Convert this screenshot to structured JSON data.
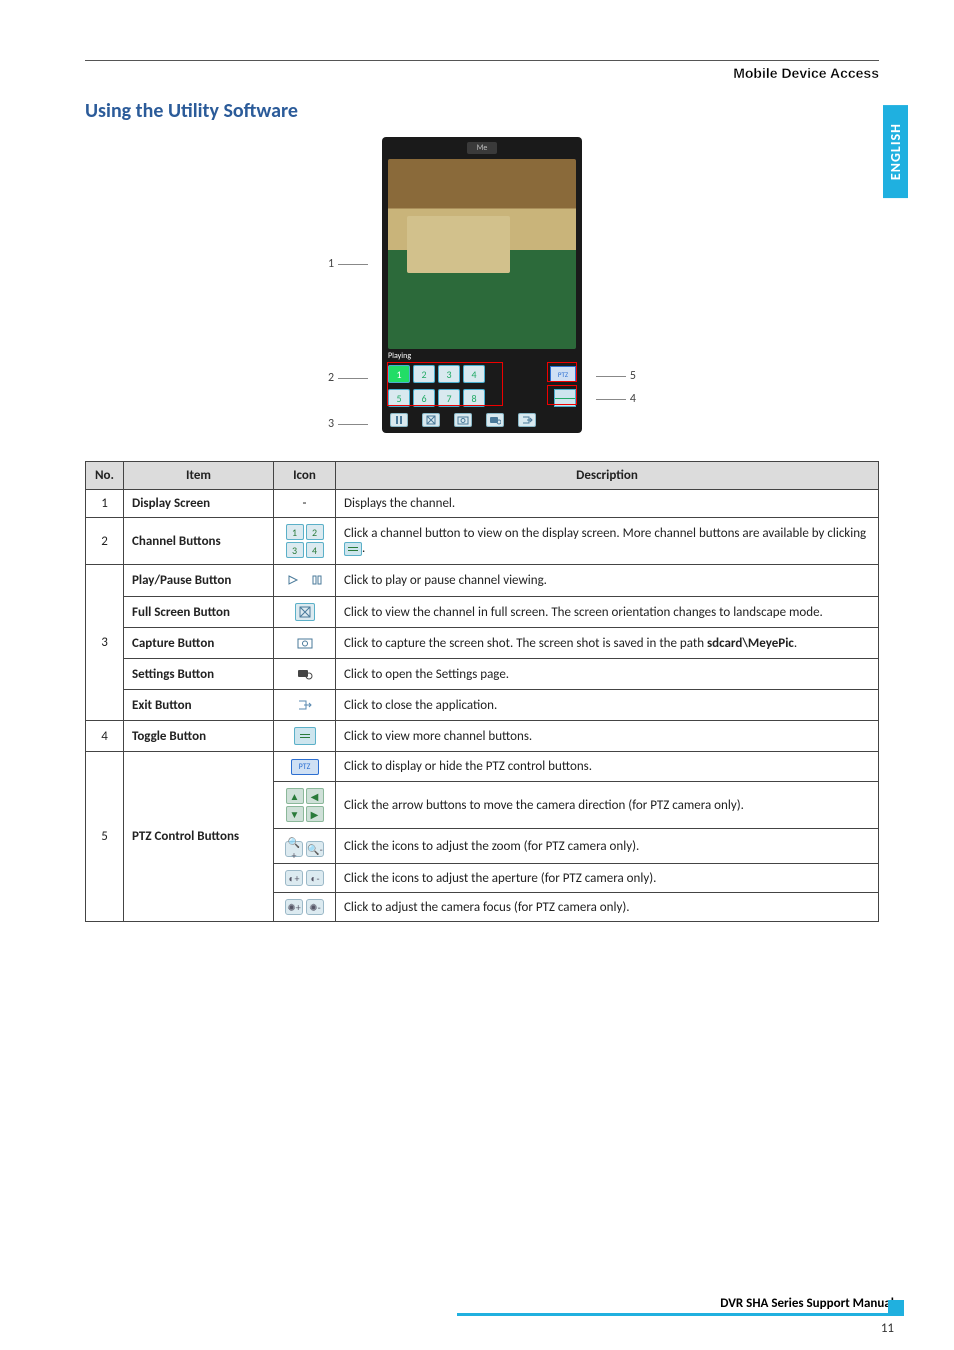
{
  "header": {
    "section": "Mobile Device Access"
  },
  "language_tab": "ENGLISH",
  "section_title": "Using the Utility Software",
  "figure": {
    "title_bar": "Me",
    "status_text": "Playing",
    "callouts": {
      "c1": "1",
      "c2": "2",
      "c3": "3",
      "c4": "4",
      "c5": "5"
    },
    "channel_labels": [
      "1",
      "2",
      "3",
      "4",
      "5",
      "6",
      "7",
      "8"
    ],
    "ptz_label": "PTZ"
  },
  "table": {
    "headers": {
      "no": "No.",
      "item": "Item",
      "icon": "Icon",
      "desc": "Description"
    },
    "rows": {
      "r1": {
        "no": "1",
        "item": "Display Screen",
        "icon_text": "-",
        "desc": "Displays the channel."
      },
      "r2": {
        "no": "2",
        "item": "Channel Buttons",
        "desc_a": "Click a channel button to view on the display screen. More channel buttons are available by clicking ",
        "desc_b": "."
      },
      "r3no": "3",
      "r3a": {
        "item": "Play/Pause Button",
        "desc": "Click to play or pause channel viewing."
      },
      "r3b": {
        "item": "Full Screen Button",
        "desc": "Click to view the channel in full screen. The screen orientation changes to landscape mode."
      },
      "r3c": {
        "item": "Capture Button",
        "desc_a": "Click to capture the screen shot. The screen shot  is saved in the path ",
        "desc_b": "sdcard\\MeyePic",
        "desc_c": "."
      },
      "r3d": {
        "item": "Settings Button",
        "desc": "Click to open the Settings page."
      },
      "r3e": {
        "item": "Exit Button",
        "desc": "Click to close the application."
      },
      "r4": {
        "no": "4",
        "item": "Toggle Button",
        "desc": "Click to view more channel buttons."
      },
      "r5no": "5",
      "r5item": "PTZ Control Buttons",
      "r5a": {
        "desc": "Click to display or hide the PTZ control buttons."
      },
      "r5b": {
        "desc": "Click the arrow buttons to move the camera direction (for PTZ camera only)."
      },
      "r5c": {
        "desc": "Click the icons to adjust the zoom (for PTZ camera only)."
      },
      "r5d": {
        "desc": "Click the icons to adjust the aperture (for PTZ camera only)."
      },
      "r5e": {
        "desc": "Click to adjust the camera focus (for PTZ camera only)."
      }
    },
    "icon_chan": [
      "1",
      "2",
      "3",
      "4"
    ],
    "ptz_icon_label": "PTZ"
  },
  "footer": {
    "label": "DVR SHA Series Support Manual",
    "page": "11"
  }
}
